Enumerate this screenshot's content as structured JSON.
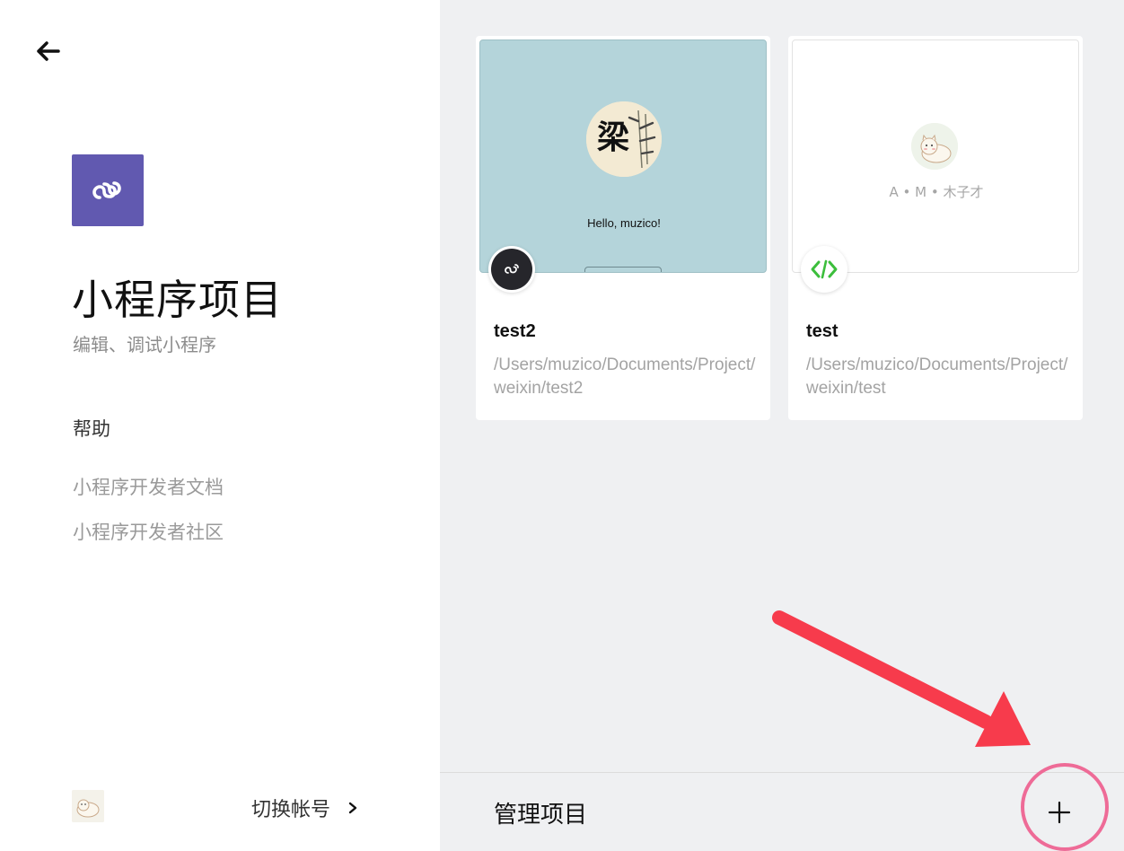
{
  "sidebar": {
    "title": "小程序项目",
    "subtitle": "编辑、调试小程序",
    "help_title": "帮助",
    "help_links": [
      "小程序开发者文档",
      "小程序开发者社区"
    ],
    "switch_account": "切换帐号",
    "brand_color": "#6159b0"
  },
  "projects": [
    {
      "name": "test2",
      "path": "/Users/muzico/Documents/Project/weixin/test2",
      "preview_text": "Hello, muzico!",
      "preview_avatar_char": "梁",
      "badge_icon": "miniprogram-link-icon"
    },
    {
      "name": "test",
      "path": "/Users/muzico/Documents/Project/weixin/test",
      "preview_caption": "A • M • 木子才",
      "badge_icon": "code-icon"
    }
  ],
  "bottom_bar": {
    "manage_label": "管理项目",
    "add_icon": "plus-icon"
  },
  "colors": {
    "right_bg": "#eff0f2",
    "annotation_arrow": "#f73b4c",
    "annotation_circle": "#ee6b97",
    "code_badge": "#3cbe3c"
  }
}
